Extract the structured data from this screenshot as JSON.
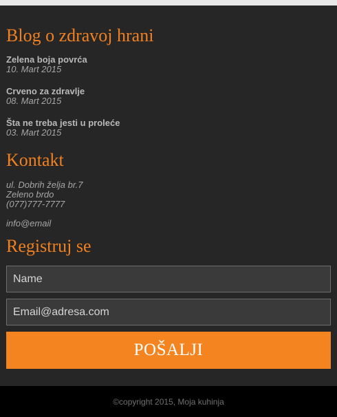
{
  "blog": {
    "title": "Blog o zdravoj hrani",
    "posts": [
      {
        "title": "Zelena boja povrća",
        "date": "10. Mart 2015"
      },
      {
        "title": "Crveno za zdravlje",
        "date": "08. Mart 2015"
      },
      {
        "title": "Šta ne treba jesti u proleće",
        "date": "03. Mart 2015"
      }
    ]
  },
  "contact": {
    "title": "Kontakt",
    "address": "ul. Dobrih želja br.7",
    "city": "Zeleno brdo",
    "phone": "(077)777-7777",
    "email": "info@email"
  },
  "register": {
    "title": "Registruj se",
    "name_placeholder": "Name",
    "email_placeholder": "Email@adresa.com",
    "submit_label": "POŠALJI"
  },
  "footer": {
    "copyright": "©copyright 2015, Moja kuhinja"
  },
  "colors": {
    "accent": "#f3841f",
    "background": "#262626",
    "footer_background": "#000000"
  }
}
